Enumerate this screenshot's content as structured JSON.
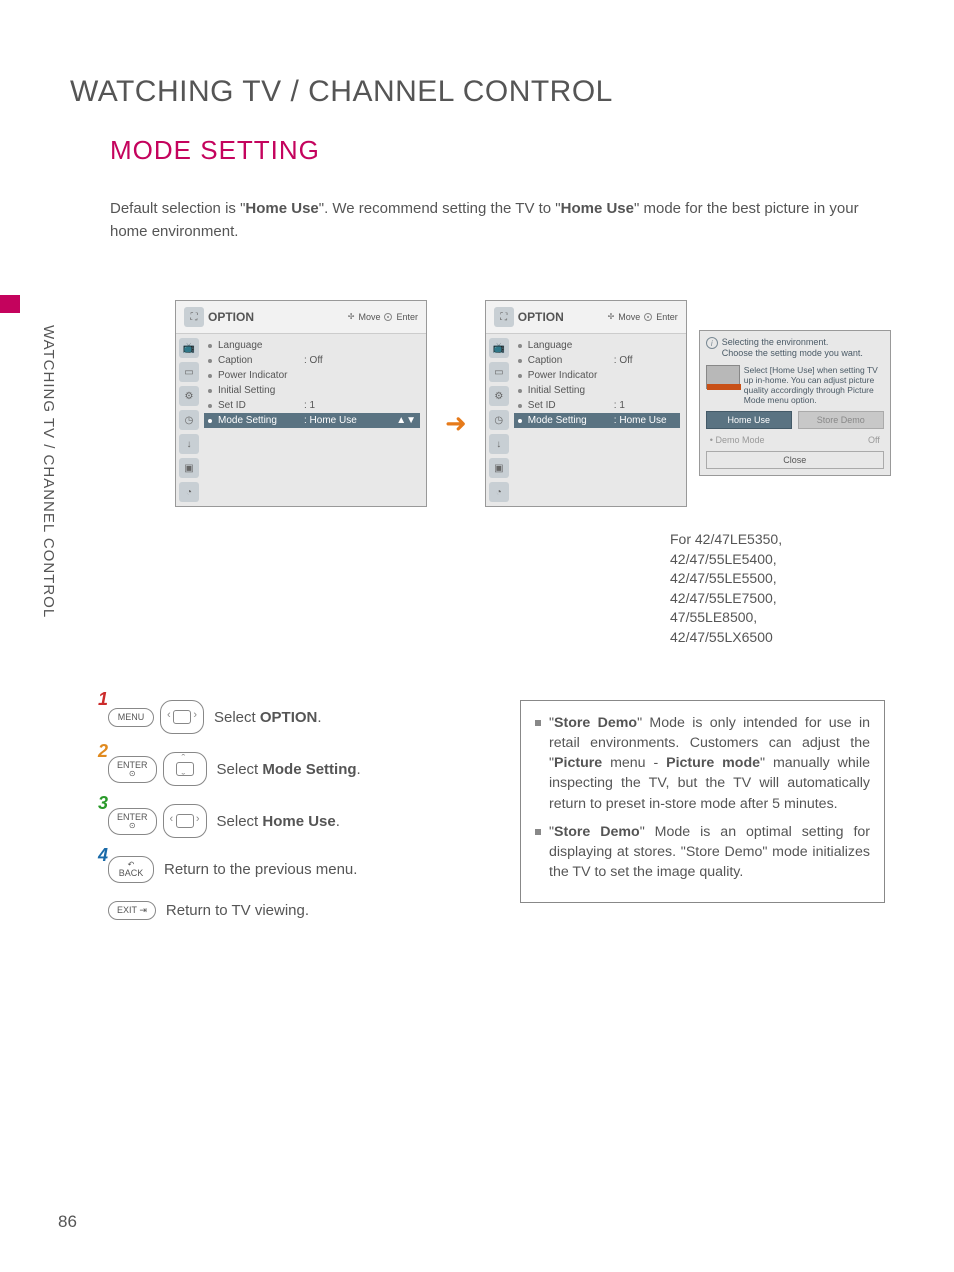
{
  "page": {
    "main_title": "WATCHING TV / CHANNEL CONTROL",
    "vertical_label": "WATCHING TV / CHANNEL CONTROL",
    "section_title": "MODE SETTING",
    "intro_pre": "Default selection is \"",
    "intro_bold1": "Home Use",
    "intro_mid": "\". We recommend setting the TV to \"",
    "intro_bold2": "Home Use",
    "intro_post": "\" mode for the best picture in your home environment.",
    "page_number": "86"
  },
  "osd": {
    "title": "OPTION",
    "move": "Move",
    "enter": "Enter",
    "items": [
      {
        "label": "Language",
        "value": ""
      },
      {
        "label": "Caption",
        "value": ": Off"
      },
      {
        "label": "Power Indicator",
        "value": ""
      },
      {
        "label": "Initial Setting",
        "value": ""
      },
      {
        "label": "Set ID",
        "value": ": 1"
      },
      {
        "label": "Mode Setting",
        "value": ": Home Use"
      }
    ]
  },
  "popup": {
    "header_line1": "Selecting the environment.",
    "header_line2": "Choose the setting mode you want.",
    "explain": "Select [Home Use] when setting TV up in-home. You can adjust picture quality accordingly through Picture Mode menu option.",
    "btn_home": "Home Use",
    "btn_store": "Store Demo",
    "demo_label": "• Demo Mode",
    "demo_value": "Off",
    "close": "Close"
  },
  "model_note": "For 42/47LE5350, 42/47/55LE5400, 42/47/55LE5500, 42/47/55LE7500, 47/55LE8500, 42/47/55LX6500",
  "steps": {
    "s1_btn": "MENU",
    "s1_pre": "Select ",
    "s1_b": "OPTION",
    "s1_post": ".",
    "s2_btn": "ENTER",
    "s2_pre": "Select ",
    "s2_b": "Mode Setting",
    "s2_post": ".",
    "s3_btn": "ENTER",
    "s3_pre": "Select ",
    "s3_b": "Home Use",
    "s3_post": ".",
    "s4_btn": "BACK",
    "s4_text": "Return to the previous menu.",
    "s5_btn": "EXIT",
    "s5_text": "Return to TV viewing."
  },
  "notes": {
    "n1_pre": "\"",
    "n1_b1": "Store Demo",
    "n1_mid1": "\" Mode is only intended for use in retail environments. Customers can adjust the \"",
    "n1_b2": "Picture",
    "n1_mid2": " menu - ",
    "n1_b3": "Picture mode",
    "n1_post": "\" manually while inspecting the TV, but the TV will automatically return to preset in-store mode after 5 minutes.",
    "n2_pre": "\"",
    "n2_b1": "Store Demo",
    "n2_post": "\" Mode is an optimal setting for displaying at stores. \"Store Demo\" mode initializes the TV to set the image quality."
  }
}
